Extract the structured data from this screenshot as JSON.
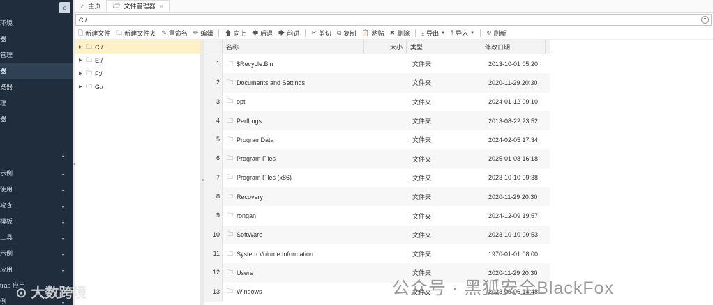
{
  "nav": {
    "items": [
      {
        "label": "环境",
        "active": false
      },
      {
        "label": "器",
        "active": false
      },
      {
        "label": "管理",
        "active": false
      },
      {
        "label": "器",
        "active": true
      },
      {
        "label": "览器",
        "active": false
      },
      {
        "label": "理",
        "active": false
      },
      {
        "label": "器",
        "active": false
      }
    ],
    "groups": [
      {
        "label": "",
        "chevron": "up"
      },
      {
        "label": "示例",
        "chevron": "down"
      },
      {
        "label": "使用",
        "chevron": "down"
      },
      {
        "label": "攻查",
        "chevron": "down"
      },
      {
        "label": "模板",
        "chevron": "down"
      },
      {
        "label": "工具",
        "chevron": "down"
      },
      {
        "label": "示例",
        "chevron": "down"
      },
      {
        "label": "应用",
        "chevron": "down"
      },
      {
        "label": "trap 应用",
        "chevron": "down"
      },
      {
        "label": "例",
        "chevron": "down"
      }
    ]
  },
  "tabs": [
    {
      "label": "主页",
      "icon": "home-icon",
      "active": false
    },
    {
      "label": "文件管理器",
      "icon": "folder-open-icon",
      "active": true,
      "close": "×"
    }
  ],
  "address": {
    "value": "C:/"
  },
  "toolbar": [
    {
      "label": "新建文件",
      "icon": "new-file-icon",
      "glyph": "🗋"
    },
    {
      "label": "新建文件夹",
      "icon": "new-folder-icon",
      "glyph": "🗀"
    },
    {
      "label": "重命名",
      "icon": "rename-icon",
      "glyph": "✎"
    },
    {
      "label": "编辑",
      "icon": "edit-icon",
      "glyph": "✏"
    },
    {
      "sep": true
    },
    {
      "label": "向上",
      "icon": "arrow-up-icon",
      "glyph": "🡅"
    },
    {
      "label": "后退",
      "icon": "arrow-left-icon",
      "glyph": "🡄"
    },
    {
      "label": "前进",
      "icon": "arrow-right-icon",
      "glyph": "🡆"
    },
    {
      "sep": true
    },
    {
      "label": "剪切",
      "icon": "cut-icon",
      "glyph": "✂"
    },
    {
      "label": "复制",
      "icon": "copy-icon",
      "glyph": "⧉"
    },
    {
      "label": "粘贴",
      "icon": "paste-icon",
      "glyph": "📋"
    },
    {
      "label": "删除",
      "icon": "delete-icon",
      "glyph": "✖"
    },
    {
      "sep": true
    },
    {
      "label": "导出",
      "icon": "export-icon",
      "glyph": "⤓",
      "caret": true
    },
    {
      "label": "导入",
      "icon": "import-icon",
      "glyph": "⤒",
      "caret": true
    },
    {
      "sep": true
    },
    {
      "label": "刷新",
      "icon": "refresh-icon",
      "glyph": "↻"
    }
  ],
  "tree": [
    {
      "label": "C:/",
      "selected": true
    },
    {
      "label": "E:/",
      "selected": false
    },
    {
      "label": "F:/",
      "selected": false
    },
    {
      "label": "G:/",
      "selected": false
    }
  ],
  "grid": {
    "columns": {
      "name": "名称",
      "size": "大小",
      "type": "类型",
      "date": "修改日期"
    },
    "rows": [
      {
        "num": "1",
        "name": "$Recycle.Bin",
        "size": "",
        "type": "文件夹",
        "date": "2013-10-01 05:20"
      },
      {
        "num": "2",
        "name": "Documents and Settings",
        "size": "",
        "type": "文件夹",
        "date": "2020-11-29 20:30"
      },
      {
        "num": "3",
        "name": "opt",
        "size": "",
        "type": "文件夹",
        "date": "2024-01-12 09:10"
      },
      {
        "num": "4",
        "name": "PerfLogs",
        "size": "",
        "type": "文件夹",
        "date": "2013-08-22 23:52"
      },
      {
        "num": "5",
        "name": "ProgramData",
        "size": "",
        "type": "文件夹",
        "date": "2024-02-05 17:34"
      },
      {
        "num": "6",
        "name": "Program Files",
        "size": "",
        "type": "文件夹",
        "date": "2025-01-08 16:18"
      },
      {
        "num": "7",
        "name": "Program Files (x86)",
        "size": "",
        "type": "文件夹",
        "date": "2023-10-10 09:38"
      },
      {
        "num": "8",
        "name": "Recovery",
        "size": "",
        "type": "文件夹",
        "date": "2020-11-29 20:30"
      },
      {
        "num": "9",
        "name": "rongan",
        "size": "",
        "type": "文件夹",
        "date": "2024-12-09 19:57"
      },
      {
        "num": "10",
        "name": "SoftWare",
        "size": "",
        "type": "文件夹",
        "date": "2023-10-10 09:53"
      },
      {
        "num": "11",
        "name": "System Volume Information",
        "size": "",
        "type": "文件夹",
        "date": "1970-01-01 08:00"
      },
      {
        "num": "12",
        "name": "Users",
        "size": "",
        "type": "文件夹",
        "date": "2020-11-29 20:30"
      },
      {
        "num": "13",
        "name": "Windows",
        "size": "",
        "type": "文件夹",
        "date": "2023-09-06 14:48"
      }
    ]
  },
  "watermarks": {
    "left": "⊙ 大数跨境",
    "right": "公众号 · 黑狐安全BlackFox"
  }
}
